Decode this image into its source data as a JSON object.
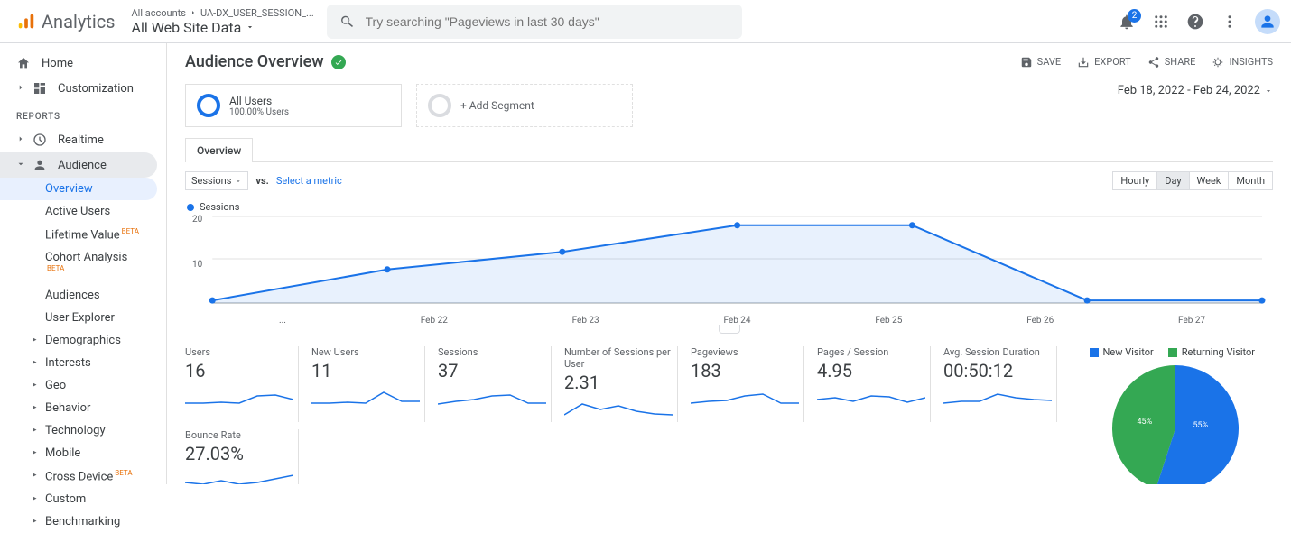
{
  "header": {
    "product": "Analytics",
    "breadcrumb1": "All accounts",
    "breadcrumb2": "UA-DX_USER_SESSION_...",
    "view": "All Web Site Data",
    "search_placeholder": "Try searching \"Pageviews in last 30 days\"",
    "notif_count": "2"
  },
  "sidebar": {
    "home": "Home",
    "custom": "Customization",
    "reports_label": "REPORTS",
    "realtime": "Realtime",
    "audience": "Audience",
    "sub": {
      "overview": "Overview",
      "active": "Active Users",
      "lifetime": "Lifetime Value",
      "cohort": "Cohort Analysis",
      "audiences": "Audiences",
      "userexp": "User Explorer",
      "demo": "Demographics",
      "interests": "Interests",
      "geo": "Geo",
      "behavior": "Behavior",
      "tech": "Technology",
      "mobile": "Mobile",
      "cross": "Cross Device",
      "customrep": "Custom",
      "bench": "Benchmarking"
    },
    "beta": "BETA"
  },
  "page": {
    "title": "Audience Overview",
    "save": "SAVE",
    "export": "EXPORT",
    "share": "SHARE",
    "insights": "INSIGHTS",
    "segments": {
      "all_users": "All Users",
      "all_users_sub": "100.00% Users",
      "add": "+ Add Segment"
    },
    "date_range": "Feb 18, 2022 - Feb 24, 2022",
    "tab_overview": "Overview",
    "metric_primary": "Sessions",
    "vs": "vs.",
    "select_metric": "Select a metric",
    "gran": {
      "hourly": "Hourly",
      "day": "Day",
      "week": "Week",
      "month": "Month"
    },
    "legend_sessions": "Sessions"
  },
  "chart_data": {
    "type": "line",
    "title": "Sessions",
    "ylabel": "",
    "xlabel": "",
    "ylim": [
      0,
      20
    ],
    "yticks": [
      "20",
      "10"
    ],
    "categories": [
      "...",
      "Feb 22",
      "Feb 23",
      "Feb 24",
      "Feb 25",
      "Feb 26",
      "Feb 27"
    ],
    "series": [
      {
        "name": "Sessions",
        "values": [
          1,
          8,
          12,
          18,
          18,
          1,
          1
        ],
        "color": "#1a73e8"
      }
    ]
  },
  "kpis": [
    {
      "label": "Users",
      "value": "16",
      "spark": [
        0.1,
        0.1,
        0.15,
        0.1,
        0.5,
        0.55,
        0.3
      ]
    },
    {
      "label": "New Users",
      "value": "11",
      "spark": [
        0.1,
        0.1,
        0.15,
        0.1,
        0.7,
        0.2,
        0.2
      ]
    },
    {
      "label": "Sessions",
      "value": "37",
      "spark": [
        0.05,
        0.2,
        0.3,
        0.5,
        0.55,
        0.1,
        0.1
      ]
    },
    {
      "label": "Number of Sessions per User",
      "value": "2.31",
      "spark": [
        0.1,
        0.7,
        0.4,
        0.6,
        0.3,
        0.15,
        0.1
      ]
    },
    {
      "label": "Pageviews",
      "value": "183",
      "spark": [
        0.1,
        0.2,
        0.25,
        0.5,
        0.6,
        0.1,
        0.1
      ]
    },
    {
      "label": "Pages / Session",
      "value": "4.95",
      "spark": [
        0.3,
        0.4,
        0.2,
        0.5,
        0.45,
        0.15,
        0.4
      ]
    },
    {
      "label": "Avg. Session Duration",
      "value": "00:50:12",
      "spark": [
        0.1,
        0.2,
        0.2,
        0.6,
        0.4,
        0.3,
        0.25
      ]
    },
    {
      "label": "Bounce Rate",
      "value": "27.03%",
      "spark": [
        0.3,
        0.2,
        0.4,
        0.2,
        0.3,
        0.5,
        0.7
      ]
    }
  ],
  "pie": {
    "legend_new": "New Visitor",
    "legend_ret": "Returning Visitor",
    "slices": [
      {
        "label": "55%",
        "value": 55,
        "color": "#1a73e8"
      },
      {
        "label": "45%",
        "value": 45,
        "color": "#34a853"
      }
    ]
  }
}
